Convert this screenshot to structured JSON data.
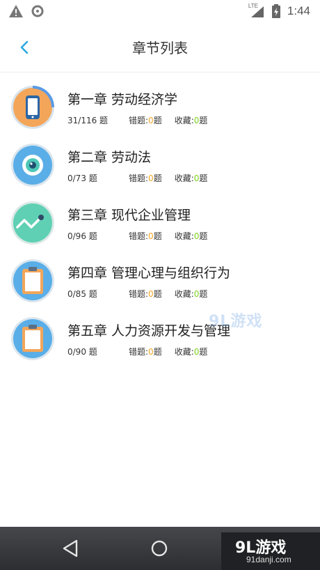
{
  "statusbar": {
    "network": "LTE",
    "time": "1:44"
  },
  "header": {
    "title": "章节列表"
  },
  "stats_labels": {
    "wrong": "错题:",
    "fav": "收藏:",
    "unit": "题"
  },
  "chapters": [
    {
      "title": "第一章 劳动经济学",
      "progress": "31/116 题",
      "wrong": "0",
      "fav": "0",
      "icon": "phone-icon"
    },
    {
      "title": "第二章 劳动法",
      "progress": "0/73 题",
      "wrong": "0",
      "fav": "0",
      "icon": "eye-icon"
    },
    {
      "title": "第三章 现代企业管理",
      "progress": "0/96 题",
      "wrong": "0",
      "fav": "0",
      "icon": "line-chart-icon"
    },
    {
      "title": "第四章 管理心理与组织行为",
      "progress": "0/85 题",
      "wrong": "0",
      "fav": "0",
      "icon": "clipboard-icon"
    },
    {
      "title": "第五章 人力资源开发与管理",
      "progress": "0/90 题",
      "wrong": "0",
      "fav": "0",
      "icon": "clipboard-icon"
    }
  ],
  "watermark": "9L游戏",
  "brand": {
    "logo": "9L游戏",
    "url": "91danji.com"
  },
  "colors": {
    "accent": "#29a8e0",
    "wrong_count": "#f5a623",
    "fav_count": "#7ed321"
  }
}
